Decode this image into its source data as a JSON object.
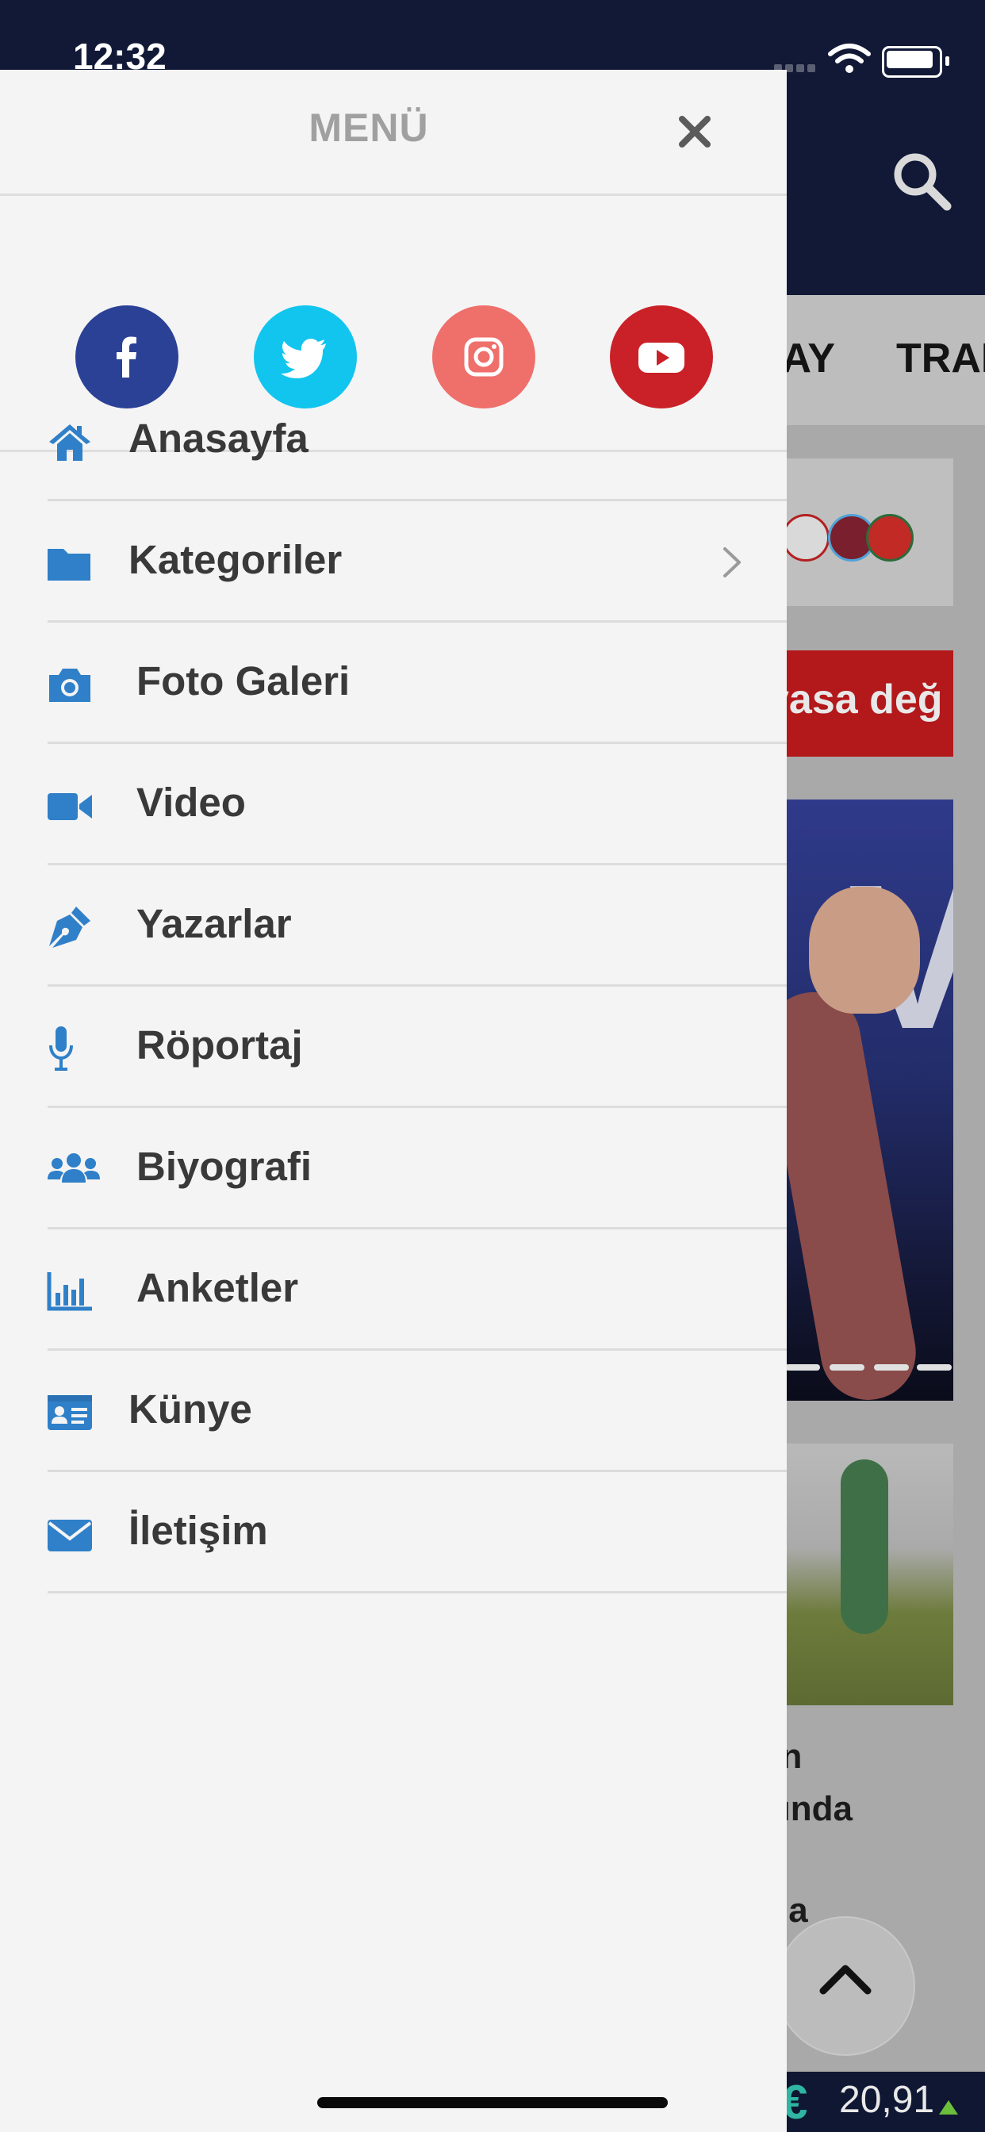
{
  "status_bar": {
    "time": "12:32"
  },
  "background": {
    "nav_tabs": [
      "RAY",
      "TRAB"
    ],
    "banner_text": "yasa değ",
    "article_lines": [
      "an",
      "kında",
      "zla"
    ],
    "ticker": {
      "currency_symbol": "€",
      "value": "20,91"
    }
  },
  "drawer": {
    "title": "MENÜ",
    "social": [
      {
        "name": "facebook",
        "icon": "facebook-icon",
        "color": "#2b4196"
      },
      {
        "name": "twitter",
        "icon": "twitter-icon",
        "color": "#11c5ef"
      },
      {
        "name": "instagram",
        "icon": "instagram-icon",
        "color": "#ef6f6b"
      },
      {
        "name": "youtube",
        "icon": "youtube-icon",
        "color": "#c92127"
      }
    ],
    "items": [
      {
        "label": "Anasayfa",
        "icon": "home-icon"
      },
      {
        "label": "Kategoriler",
        "icon": "folder-icon",
        "has_submenu": true
      },
      {
        "label": "Foto Galeri",
        "icon": "camera-icon"
      },
      {
        "label": "Video",
        "icon": "video-icon"
      },
      {
        "label": "Yazarlar",
        "icon": "pen-icon"
      },
      {
        "label": "Röportaj",
        "icon": "microphone-icon"
      },
      {
        "label": "Biyografi",
        "icon": "users-icon"
      },
      {
        "label": "Anketler",
        "icon": "bar-chart-icon"
      },
      {
        "label": "Künye",
        "icon": "id-card-icon"
      },
      {
        "label": "İletişim",
        "icon": "envelope-icon"
      }
    ],
    "icon_color": "#2f80c8"
  }
}
